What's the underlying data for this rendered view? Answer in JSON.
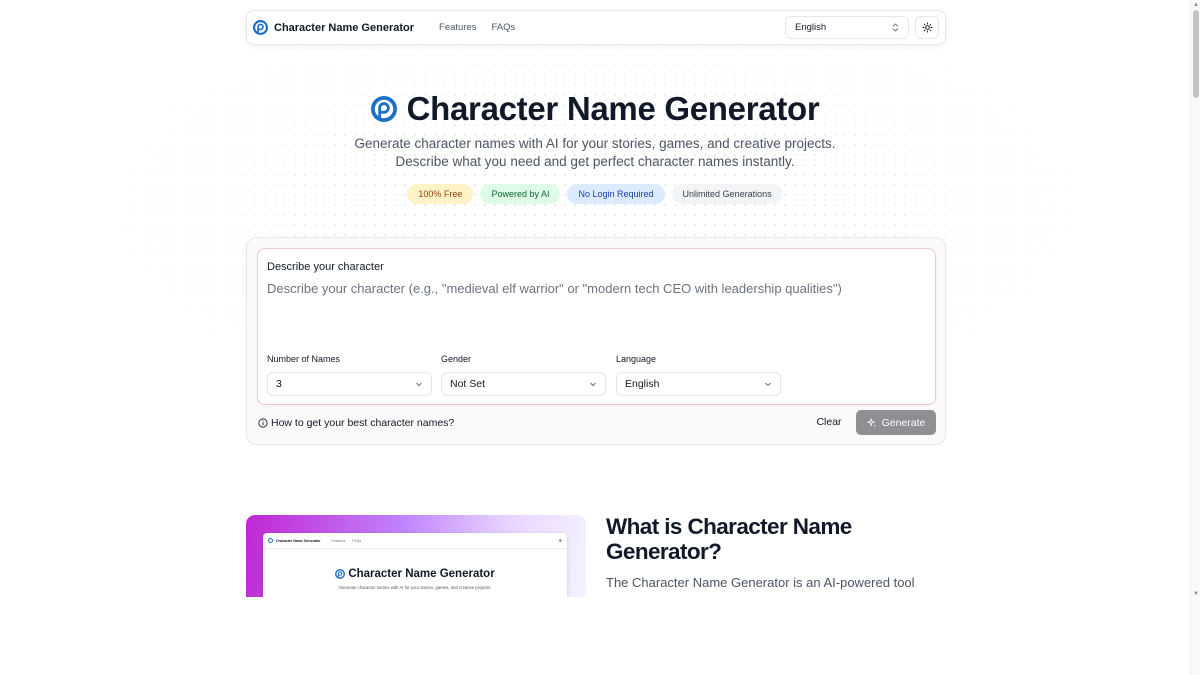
{
  "nav": {
    "brand": "Character Name Generator",
    "links": [
      "Features",
      "FAQs"
    ],
    "language": "English"
  },
  "hero": {
    "title": "Character Name Generator",
    "subtitle_line1": "Generate character names with AI for your stories, games, and creative projects.",
    "subtitle_line2": "Describe what you need and get perfect character names instantly.",
    "badges": [
      "100% Free",
      "Powered by AI",
      "No Login Required",
      "Unlimited Generations"
    ]
  },
  "form": {
    "title": "Describe your character",
    "description_placeholder": "Describe your character (e.g., \"medieval elf warrior\" or \"modern tech CEO with leadership qualities\")",
    "count_label": "Number of Names",
    "count_value": "3",
    "gender_label": "Gender",
    "gender_value": "Not Set",
    "language_label": "Language",
    "language_value": "English",
    "help_link": "How to get your best character names?",
    "clear_label": "Clear",
    "generate_label": "Generate"
  },
  "about": {
    "title": "What is Character Name Generator?",
    "description": "The Character Name Generator is an AI-powered tool",
    "preview": {
      "brand": "Character Name Generator",
      "links": [
        "Features",
        "FAQs"
      ],
      "title": "Character Name Generator",
      "subtitle": "Generate character names with AI for your stories, games, and creative projects."
    }
  },
  "colors": {
    "logo_blue": "#1d6fc4",
    "generate_button": "#8e8e93",
    "badge_free": "#fef3c7",
    "badge_ai": "#dcfce7",
    "badge_login": "#dbeafe",
    "badge_unlimited": "#f3f4f6"
  }
}
